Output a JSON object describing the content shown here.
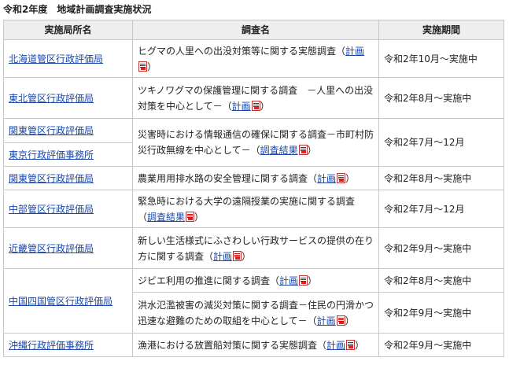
{
  "title": "令和2年度　地域計画調査実施状況",
  "headers": {
    "office": "実施局所名",
    "survey": "調査名",
    "period": "実施期間"
  },
  "rows": [
    {
      "office": "北海道管区行政評価局",
      "survey": "ヒグマの人里への出没対策等に関する実態調査（",
      "link": "計画",
      "close": "）",
      "period": "令和2年10月～実施中"
    },
    {
      "office": "東北管区行政評価局",
      "survey": "ツキノワグマの保護管理に関する調査　－人里への出没対策を中心として－（",
      "link": "計画",
      "close": "）",
      "period": "令和2年8月～実施中"
    },
    {
      "office": "関東管区行政評価局",
      "office2": "東京行政評価事務所",
      "survey": "災害時における情報通信の確保に関する調査－市町村防災行政無線を中心として－（",
      "link": "調査結果",
      "close": "）",
      "period": "令和2年7月～12月"
    },
    {
      "office": "関東管区行政評価局",
      "survey": "農業用用排水路の安全管理に関する調査（",
      "link": "計画",
      "close": "）",
      "period": "令和2年8月～実施中"
    },
    {
      "office": "中部管区行政評価局",
      "survey": "緊急時における大学の遠隔授業の実施に関する調査（",
      "link": "調査結果",
      "close": "）",
      "period": "令和2年7月～12月"
    },
    {
      "office": "近畿管区行政評価局",
      "survey": "新しい生活様式にふさわしい行政サービスの提供の在り方に関する調査（",
      "link": "計画",
      "close": "）",
      "period": "令和2年9月～実施中"
    },
    {
      "office": "中国四国管区行政評価局",
      "survey": "ジビエ利用の推進に関する調査（",
      "link": "計画",
      "close": "）",
      "period": "令和2年8月～実施中"
    },
    {
      "survey": "洪水氾濫被害の減災対策に関する調査－住民の円滑かつ迅速な避難のための取組を中心として－（",
      "link": "計画",
      "close": "）",
      "period": "令和2年9月～実施中"
    },
    {
      "office": "沖縄行政評価事務所",
      "survey": "漁港における放置船対策に関する実態調査（",
      "link": "計画",
      "close": "）",
      "period": "令和2年9月～実施中"
    }
  ],
  "icons": {
    "pdf": "pdf-icon"
  }
}
